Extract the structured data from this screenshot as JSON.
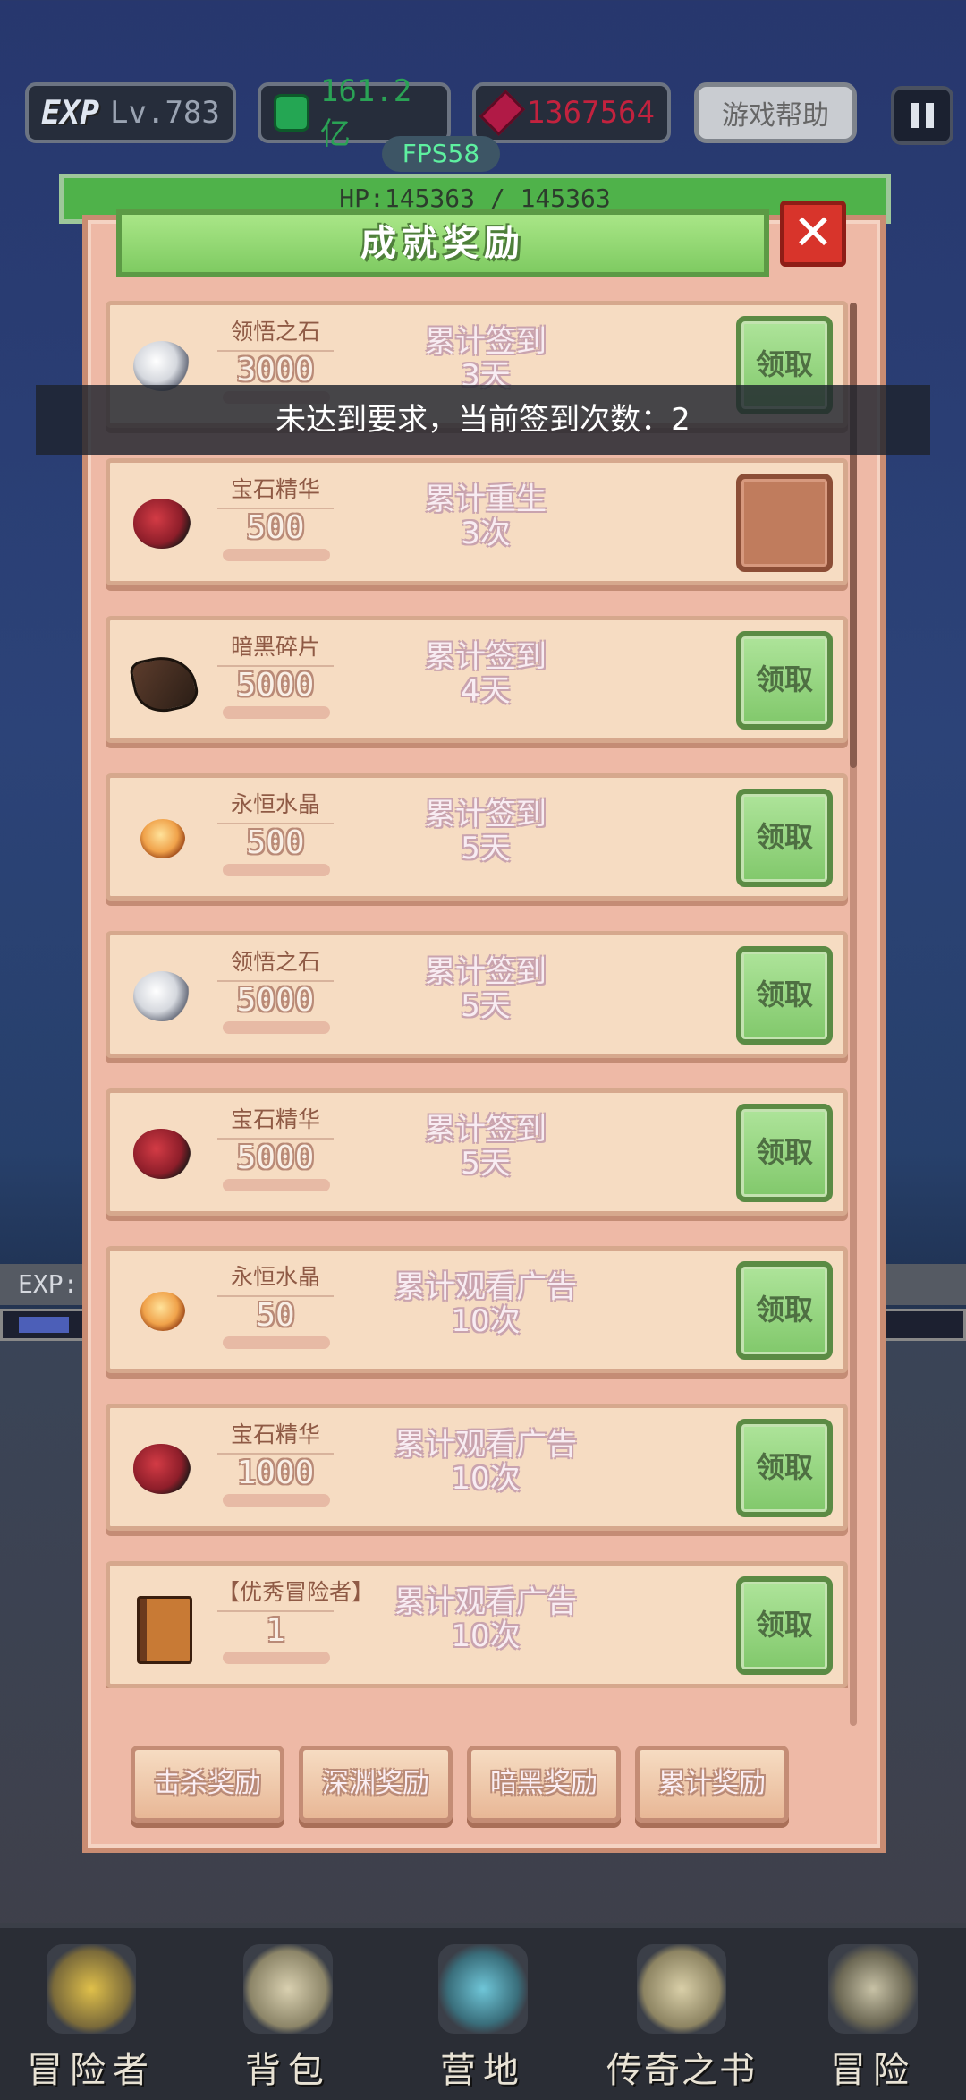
{
  "hud": {
    "exp_badge": "EXP",
    "level": "Lv.783",
    "currency_green": "161.2亿",
    "currency_red": "1367564",
    "help_label": "游戏帮助",
    "fps": "FPS58",
    "hp": "HP:145363 / 145363"
  },
  "background": {
    "exp_row": "EXP:"
  },
  "modal": {
    "title": "成就奖励",
    "close_label": "✕",
    "items": [
      {
        "name": "领悟之石",
        "qty": "3000",
        "cond1": "累计签到",
        "cond2": "3天",
        "button": "领取",
        "icon": "stone-icon",
        "locked": false
      },
      {
        "name": "宝石精华",
        "qty": "500",
        "cond1": "累计重生",
        "cond2": "3次",
        "button": "",
        "icon": "gem-essence-icon",
        "locked": true
      },
      {
        "name": "暗黑碎片",
        "qty": "5000",
        "cond1": "累计签到",
        "cond2": "4天",
        "button": "领取",
        "icon": "dark-shard-icon",
        "locked": false
      },
      {
        "name": "永恒水晶",
        "qty": "500",
        "cond1": "累计签到",
        "cond2": "5天",
        "button": "领取",
        "icon": "crystal-icon",
        "locked": false
      },
      {
        "name": "领悟之石",
        "qty": "5000",
        "cond1": "累计签到",
        "cond2": "5天",
        "button": "领取",
        "icon": "stone-icon",
        "locked": false
      },
      {
        "name": "宝石精华",
        "qty": "5000",
        "cond1": "累计签到",
        "cond2": "5天",
        "button": "领取",
        "icon": "gem-essence-icon",
        "locked": false
      },
      {
        "name": "永恒水晶",
        "qty": "50",
        "cond1": "累计观看广告",
        "cond2": "10次",
        "button": "领取",
        "icon": "crystal-icon",
        "locked": false
      },
      {
        "name": "宝石精华",
        "qty": "1000",
        "cond1": "累计观看广告",
        "cond2": "10次",
        "button": "领取",
        "icon": "gem-essence-icon",
        "locked": false
      },
      {
        "name": "【优秀冒险者】",
        "qty": "1",
        "cond1": "累计观看广告",
        "cond2": "10次",
        "button": "领取",
        "icon": "book-icon",
        "locked": false
      }
    ],
    "tabs": [
      "击杀奖励",
      "深渊奖励",
      "暗黑奖励",
      "累计奖励"
    ]
  },
  "toast": "未达到要求，当前签到次数：2",
  "nav": [
    "冒险者",
    "背包",
    "营地",
    "传奇之书",
    "冒险"
  ]
}
